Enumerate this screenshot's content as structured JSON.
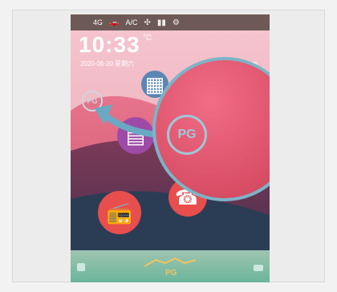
{
  "status": {
    "network": "4G",
    "ac": "A/C",
    "icons": [
      "signal-icon",
      "car-icon",
      "ac-icon",
      "fan-icon",
      "battery-icon",
      "settings-icon"
    ]
  },
  "clock": {
    "time": "10:33",
    "date_small": "2020-06-20 星期六",
    "date_large": "2020-06-20"
  },
  "weather": {
    "text": "°C"
  },
  "apps": [
    {
      "name": "document-app",
      "icon": "document-icon"
    },
    {
      "name": "map-app",
      "icon": "map-icon"
    },
    {
      "name": "radio-app",
      "icon": "radio-icon"
    },
    {
      "name": "phone-app",
      "icon": "phone-icon"
    }
  ],
  "pg": {
    "small": "PG",
    "large": "PG"
  },
  "bottom": {
    "label": "PG"
  },
  "colors": {
    "accent": "#7db3c6",
    "primary": "#d84f66",
    "status_bg": "#6d5a56"
  }
}
